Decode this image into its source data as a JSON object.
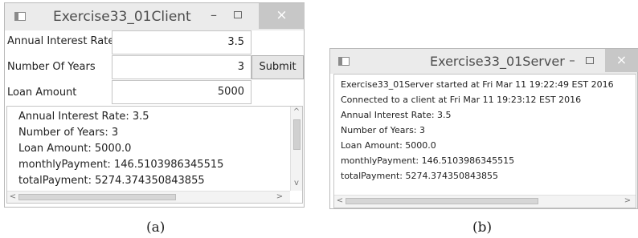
{
  "client": {
    "title": "Exercise33_01Client",
    "controls": {
      "minimize": "–",
      "close": "×"
    },
    "form": {
      "interest_label": "Annual Interest Rate",
      "interest_value": "3.5",
      "years_label": "Number Of Years",
      "years_value": "3",
      "amount_label": "Loan Amount",
      "amount_value": "5000",
      "submit_label": "Submit"
    },
    "output_lines": [
      "Annual Interest Rate: 3.5",
      "Number of Years: 3",
      "Loan Amount: 5000.0",
      "monthlyPayment: 146.5103986345515",
      "totalPayment: 5274.374350843855"
    ]
  },
  "server": {
    "title": "Exercise33_01Server",
    "controls": {
      "minimize": "–",
      "close": "×"
    },
    "log_lines": [
      "Exercise33_01Server started at Fri Mar 11 19:22:49 EST 2016",
      "Connected to a client  at Fri Mar 11 19:23:12 EST 2016",
      "Annual Interest Rate: 3.5",
      "Number of Years: 3",
      "Loan Amount: 5000.0",
      "monthlyPayment: 146.5103986345515",
      "totalPayment: 5274.374350843855"
    ]
  },
  "scroll_arrows": {
    "up": "^",
    "down": "v",
    "left": "<",
    "right": ">"
  },
  "captions": {
    "a": "(a)",
    "b": "(b)"
  }
}
